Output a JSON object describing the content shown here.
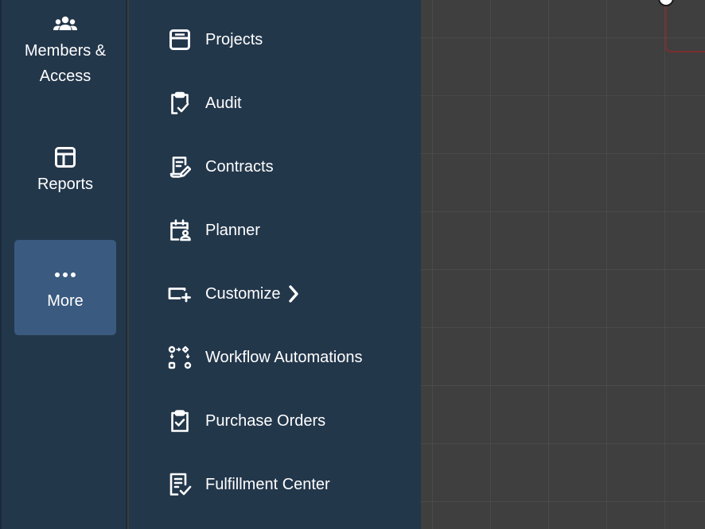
{
  "colors": {
    "sidebar_bg": "#23374b",
    "active_item_bg": "#3a5a7f",
    "canvas_bg": "#3f3f3f",
    "text": "#ffffff",
    "node_border": "#7a2e2e"
  },
  "rail": {
    "items": [
      {
        "label": "Members & Access",
        "icon": "members-icon"
      },
      {
        "label": "Reports",
        "icon": "reports-icon"
      },
      {
        "label": "More",
        "icon": "more-dots-icon",
        "active": true
      }
    ]
  },
  "menu": {
    "items": [
      {
        "label": "Projects",
        "icon": "projects-icon"
      },
      {
        "label": "Audit",
        "icon": "clipboard-check-icon"
      },
      {
        "label": "Contracts",
        "icon": "contract-icon"
      },
      {
        "label": "Planner",
        "icon": "calendar-person-icon"
      },
      {
        "label": "Customize",
        "icon": "customize-icon",
        "submenu_icon": "chevron-right-icon"
      },
      {
        "label": "Workflow Automations",
        "icon": "workflow-icon"
      },
      {
        "label": "Purchase Orders",
        "icon": "clipboard-checked-icon"
      },
      {
        "label": "Fulfillment Center",
        "icon": "document-check-icon"
      }
    ]
  }
}
